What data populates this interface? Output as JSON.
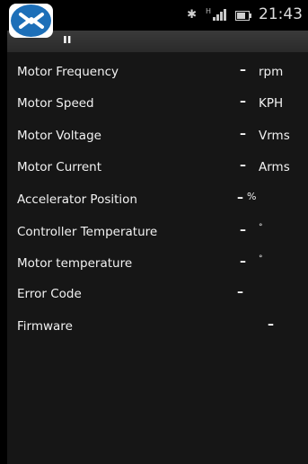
{
  "status_bar": {
    "time": "21:43",
    "bluetooth_icon": "bluetooth-icon",
    "network_label": "H"
  },
  "app": {
    "title": "ıı"
  },
  "rows": [
    {
      "label": "Motor Frequency",
      "value": "–",
      "unit": "rpm"
    },
    {
      "label": "Motor Speed",
      "value": "–",
      "unit": "KPH"
    },
    {
      "label": "Motor Voltage",
      "value": "–",
      "unit": "Vrms"
    },
    {
      "label": "Motor Current",
      "value": "–",
      "unit": "Arms"
    },
    {
      "label": "Accelerator Position",
      "value": "–",
      "unit": "%"
    },
    {
      "label": "Controller Temperature",
      "value": "–",
      "unit": "°"
    },
    {
      "label": "Motor temperature",
      "value": "–",
      "unit": "°"
    },
    {
      "label": "Error Code",
      "value": "–",
      "unit": ""
    },
    {
      "label": "Firmware",
      "value": "–",
      "unit": ""
    }
  ],
  "colors": {
    "background": "#161616",
    "title_bar": "#2f2f2f",
    "logo_blue": "#1d6fb8"
  }
}
